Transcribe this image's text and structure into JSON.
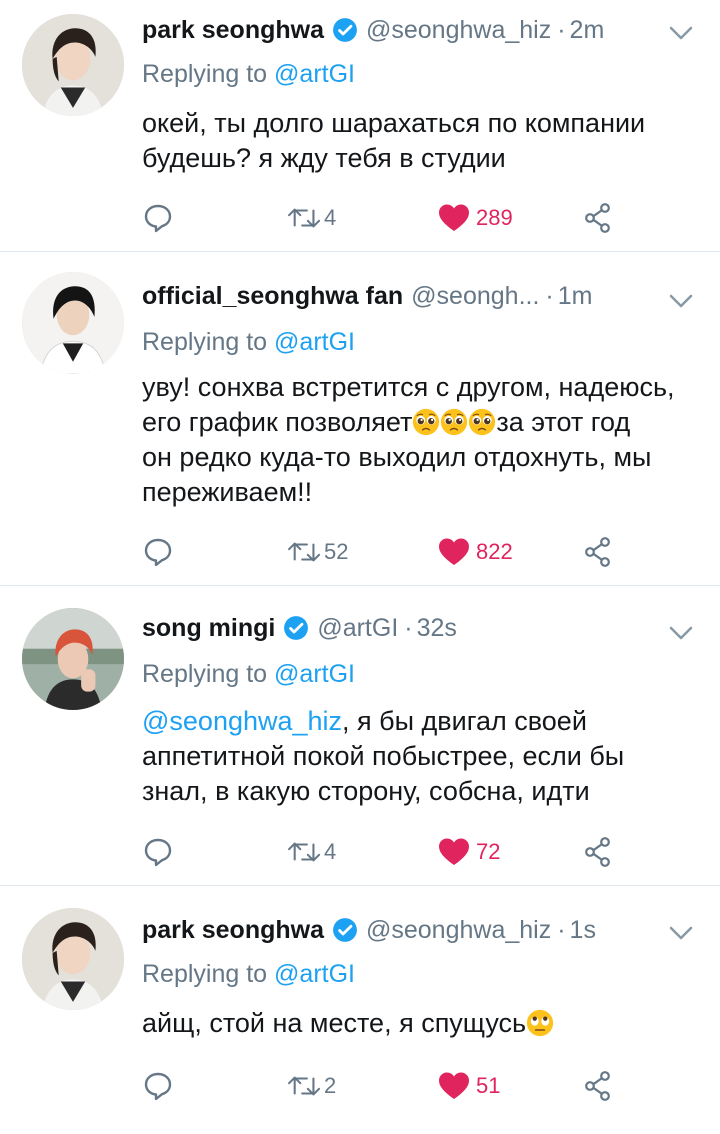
{
  "reply_prefix": "Replying to",
  "tweets": [
    {
      "name": "park seonghwa",
      "verified": true,
      "handle": "@seonghwa_hiz",
      "time": "2m",
      "replying_to": "@artGI",
      "text": "окей, ты долго шарахаться по компании будешь? я жду тебя в студии",
      "retweets": "4",
      "likes": "289"
    },
    {
      "name": "official_seonghwa fan",
      "verified": false,
      "handle": "@seongh...",
      "time": "1m",
      "replying_to": "@artGI",
      "text_line1": "уву! сонхва встретится с другом, надеюсь,",
      "text_line2a": "его график позволяет",
      "text_line2b": "за этот год",
      "text_line3": "он редко куда-то выходил отдохнуть, мы",
      "text_line4": "переживаем!!",
      "retweets": "52",
      "likes": "822"
    },
    {
      "name": "song mingi",
      "verified": true,
      "handle": "@artGI",
      "time": "32s",
      "replying_to": "@artGI",
      "mention": "@seonghwa_hiz",
      "text": ", я бы двигал своей аппетитной покой побыстрее, если бы знал, в какую сторону, собсна, идти",
      "retweets": "4",
      "likes": "72"
    },
    {
      "name": "park seonghwa",
      "verified": true,
      "handle": "@seonghwa_hiz",
      "time": "1s",
      "replying_to": "@artGI",
      "text": "айщ, стой на месте, я спущусь",
      "retweets": "2",
      "likes": "51"
    }
  ],
  "colors": {
    "accent": "#1da1f2",
    "like": "#e0245e",
    "muted": "#657786"
  },
  "icons": [
    "verified-badge-icon",
    "chevron-down-icon",
    "reply-icon",
    "retweet-icon",
    "heart-icon",
    "share-icon",
    "pleading-face-emoji",
    "eye-roll-emoji"
  ]
}
